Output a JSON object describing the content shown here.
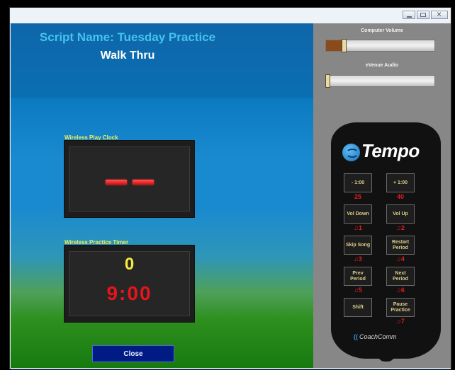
{
  "window": {
    "controls": [
      "minimize",
      "maximize",
      "close"
    ]
  },
  "main": {
    "script_name": "Script Name: Tuesday Practice",
    "subtitle": "Walk Thru",
    "play_clock": {
      "label": "Wireless Play Clock",
      "display": [
        "-",
        "-"
      ]
    },
    "practice_timer": {
      "label": "Wireless Practice Timer",
      "count": "0",
      "time": "9:00"
    },
    "close_label": "Close"
  },
  "side": {
    "computer_volume": {
      "label": "Computer Volume",
      "level_percent": 15
    },
    "evenue_audio": {
      "label": "eVenue Audio",
      "level_percent": 0
    },
    "remote": {
      "logo": "Tempo",
      "buttons": [
        {
          "label": "- 1:00",
          "number": "25"
        },
        {
          "label": "+ 1:00",
          "number": "40"
        },
        {
          "label": "Vol Down",
          "number": "♫1"
        },
        {
          "label": "Vol Up",
          "number": "♫2"
        },
        {
          "label": "Skip Song",
          "number": "♫3"
        },
        {
          "label": "Restart Period",
          "number": "♫4"
        },
        {
          "label": "Prev Period",
          "number": "♫5"
        },
        {
          "label": "Next Period",
          "number": "♫6"
        },
        {
          "label": "Shift",
          "number": ""
        },
        {
          "label": "Pause Practice",
          "number": "♫7"
        }
      ],
      "brand": "CoachComm"
    }
  },
  "colors": {
    "accent_blue": "#45c3ee",
    "timer_red": "#e8141a",
    "count_yellow": "#f5ec3c",
    "close_button": "#001c84"
  }
}
